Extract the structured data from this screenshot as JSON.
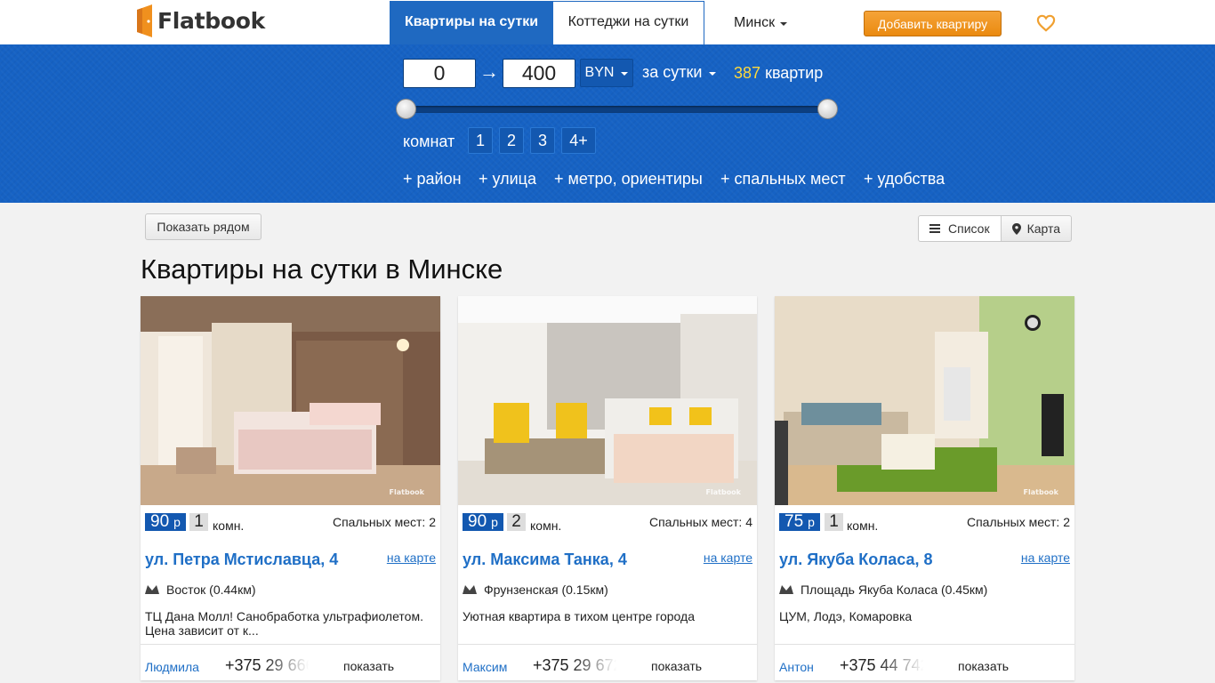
{
  "header": {
    "logo_text": "Flatbook",
    "tab_active": "Квартиры на сутки",
    "tab_other": "Коттеджи на сутки",
    "city": "Минск",
    "add_button": "Добавить квартиру",
    "favorites_icon": "heart-icon",
    "accent_color": "#1f69c1",
    "button_color": "#ea8a10"
  },
  "filter": {
    "price_from": "0",
    "price_to": "400",
    "arrow": "→",
    "currency": "BYN",
    "period": "за сутки",
    "count_number": "387",
    "count_label": "квартир",
    "rooms_label": "комнат",
    "rooms": [
      "1",
      "2",
      "3",
      "4+"
    ],
    "links": [
      "+ район",
      "+ улица",
      "+ метро, ориентиры",
      "+ спальных мест",
      "+ удобства"
    ]
  },
  "toolbar": {
    "near_button": "Показать рядом",
    "view_list": "Список",
    "view_map": "Карта"
  },
  "page_title": "Квартиры на сутки в Минске",
  "listings": [
    {
      "price": "90",
      "price_unit": "р",
      "rooms": "1",
      "rooms_unit": "комн.",
      "beds": "Спальных мест: 2",
      "address": "ул. Петра Мстиславца, 4",
      "map_link": "на карте",
      "metro": "Восток (0.44км)",
      "description": "ТЦ Дана Молл! Санобработка ультрафиолетом. Цена зависит от к...",
      "owner": "Людмила",
      "phone": "+375 29 666",
      "show": "показать",
      "watermark": "Flatbook"
    },
    {
      "price": "90",
      "price_unit": "р",
      "rooms": "2",
      "rooms_unit": "комн.",
      "beds": "Спальных мест: 4",
      "address": "ул. Максима Танка, 4",
      "map_link": "на карте",
      "metro": "Фрунзенская (0.15км)",
      "description": "Уютная квартира в тихом центре города",
      "owner": "Максим",
      "phone": "+375 29 672",
      "show": "показать",
      "watermark": "Flatbook"
    },
    {
      "price": "75",
      "price_unit": "р",
      "rooms": "1",
      "rooms_unit": "комн.",
      "beds": "Спальных мест: 2",
      "address": "ул. Якуба Коласа, 8",
      "map_link": "на карте",
      "metro": "Площадь Якуба Коласа (0.45км)",
      "description": "ЦУМ, Лодэ, Комаровка",
      "owner": "Антон",
      "phone": "+375 44 742",
      "show": "показать",
      "watermark": "Flatbook"
    }
  ]
}
